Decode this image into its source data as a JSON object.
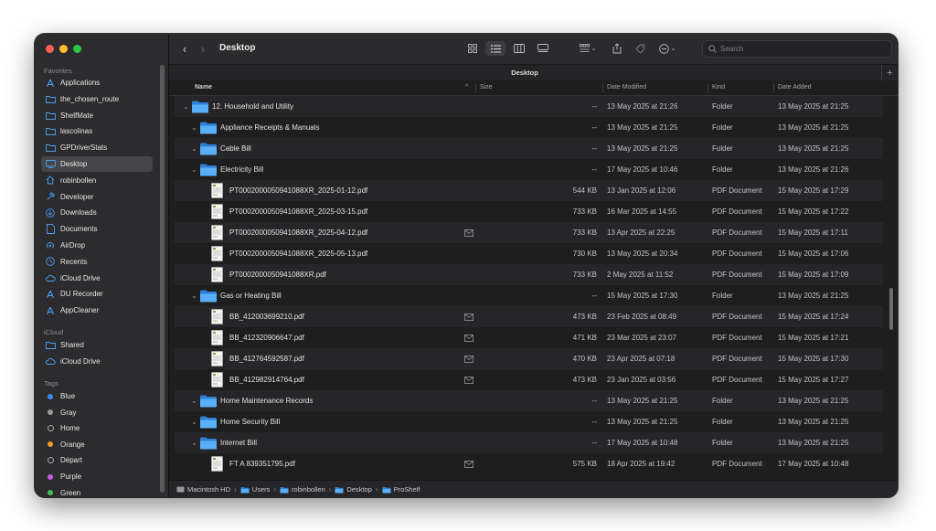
{
  "sidebar": {
    "favorites_title": "Favorites",
    "favorites": [
      {
        "label": "Applications",
        "icon": "applications-icon",
        "selected": false
      },
      {
        "label": "the_chosen_route",
        "icon": "folder-icon",
        "selected": false
      },
      {
        "label": "ShelfMate",
        "icon": "folder-icon",
        "selected": false
      },
      {
        "label": "lascolinas",
        "icon": "folder-icon",
        "selected": false
      },
      {
        "label": "GPDriverStats",
        "icon": "folder-icon",
        "selected": false
      },
      {
        "label": "Desktop",
        "icon": "desktop-icon",
        "selected": true
      },
      {
        "label": "robinbollen",
        "icon": "home-icon",
        "selected": false
      },
      {
        "label": "Developer",
        "icon": "hammer-icon",
        "selected": false
      },
      {
        "label": "Downloads",
        "icon": "download-icon",
        "selected": false
      },
      {
        "label": "Documents",
        "icon": "document-icon",
        "selected": false
      },
      {
        "label": "AirDrop",
        "icon": "airdrop-icon",
        "selected": false
      },
      {
        "label": "Recents",
        "icon": "clock-icon",
        "selected": false
      },
      {
        "label": "iCloud Drive",
        "icon": "cloud-icon",
        "selected": false
      },
      {
        "label": "DU Recorder",
        "icon": "app-icon",
        "selected": false
      },
      {
        "label": "AppCleaner",
        "icon": "app-icon",
        "selected": false
      }
    ],
    "icloud_title": "iCloud",
    "icloud": [
      {
        "label": "Shared",
        "icon": "shared-folder-icon"
      },
      {
        "label": "iCloud Drive",
        "icon": "cloud-icon"
      }
    ],
    "tags_title": "Tags",
    "tags": [
      {
        "label": "Blue",
        "color": "#3a8cf0"
      },
      {
        "label": "Gray",
        "color": "#9a9a9c"
      },
      {
        "label": "Home",
        "color": "hollow"
      },
      {
        "label": "Orange",
        "color": "#f29a2e"
      },
      {
        "label": "Départ",
        "color": "hollow"
      },
      {
        "label": "Purple",
        "color": "#c65de0"
      },
      {
        "label": "Green",
        "color": "#44c25a"
      }
    ]
  },
  "toolbar": {
    "title": "Desktop",
    "search_placeholder": "Search"
  },
  "tab": {
    "title": "Desktop"
  },
  "columns": {
    "name": "Name",
    "size": "Size",
    "date_modified": "Date Modified",
    "kind": "Kind",
    "date_added": "Date Added"
  },
  "rows": [
    {
      "indent": 0,
      "disclosure": "expanded",
      "type": "folder",
      "name": "12. Household and Utility",
      "shared": false,
      "size": "--",
      "modified": "13 May 2025 at 21:26",
      "kind": "Folder",
      "added": "13 May 2025 at 21:25"
    },
    {
      "indent": 1,
      "disclosure": "expanded",
      "type": "folder",
      "name": "Appliance Receipts & Manuals",
      "shared": false,
      "size": "--",
      "modified": "13 May 2025 at 21:25",
      "kind": "Folder",
      "added": "13 May 2025 at 21:25"
    },
    {
      "indent": 1,
      "disclosure": "expanded",
      "type": "folder",
      "name": "Cable Bill",
      "shared": false,
      "size": "--",
      "modified": "13 May 2025 at 21:25",
      "kind": "Folder",
      "added": "13 May 2025 at 21:25"
    },
    {
      "indent": 1,
      "disclosure": "expanded",
      "type": "folder",
      "name": "Electricity Bill",
      "shared": false,
      "size": "--",
      "modified": "17 May 2025 at 10:46",
      "kind": "Folder",
      "added": "13 May 2025 at 21:26"
    },
    {
      "indent": 2,
      "disclosure": "none",
      "type": "pdf",
      "name": "PT0002000050941088XR_2025-01-12.pdf",
      "shared": false,
      "size": "544 KB",
      "modified": "13 Jan 2025 at 12:06",
      "kind": "PDF Document",
      "added": "15 May 2025 at 17:29"
    },
    {
      "indent": 2,
      "disclosure": "none",
      "type": "pdf",
      "name": "PT0002000050941088XR_2025-03-15.pdf",
      "shared": false,
      "size": "733 KB",
      "modified": "16 Mar 2025 at 14:55",
      "kind": "PDF Document",
      "added": "15 May 2025 at 17:22"
    },
    {
      "indent": 2,
      "disclosure": "none",
      "type": "pdf",
      "name": "PT0002000050941088XR_2025-04-12.pdf",
      "shared": true,
      "size": "733 KB",
      "modified": "13 Apr 2025 at 22:25",
      "kind": "PDF Document",
      "added": "15 May 2025 at 17:11"
    },
    {
      "indent": 2,
      "disclosure": "none",
      "type": "pdf",
      "name": "PT0002000050941088XR_2025-05-13.pdf",
      "shared": false,
      "size": "730 KB",
      "modified": "13 May 2025 at 20:34",
      "kind": "PDF Document",
      "added": "15 May 2025 at 17:06"
    },
    {
      "indent": 2,
      "disclosure": "none",
      "type": "pdf",
      "name": "PT0002000050941088XR.pdf",
      "shared": false,
      "size": "733 KB",
      "modified": "2 May 2025 at 11:52",
      "kind": "PDF Document",
      "added": "15 May 2025 at 17:09"
    },
    {
      "indent": 1,
      "disclosure": "expanded",
      "type": "folder",
      "name": "Gas or Heating Bill",
      "shared": false,
      "size": "--",
      "modified": "15 May 2025 at 17:30",
      "kind": "Folder",
      "added": "13 May 2025 at 21:25"
    },
    {
      "indent": 2,
      "disclosure": "none",
      "type": "pdf",
      "name": "BB_412003699210.pdf",
      "shared": true,
      "size": "473 KB",
      "modified": "23 Feb 2025 at 08:49",
      "kind": "PDF Document",
      "added": "15 May 2025 at 17:24"
    },
    {
      "indent": 2,
      "disclosure": "none",
      "type": "pdf",
      "name": "BB_412320906647.pdf",
      "shared": true,
      "size": "471 KB",
      "modified": "23 Mar 2025 at 23:07",
      "kind": "PDF Document",
      "added": "15 May 2025 at 17:21"
    },
    {
      "indent": 2,
      "disclosure": "none",
      "type": "pdf",
      "name": "BB_412764592587.pdf",
      "shared": true,
      "size": "470 KB",
      "modified": "23 Apr 2025 at 07:18",
      "kind": "PDF Document",
      "added": "15 May 2025 at 17:30"
    },
    {
      "indent": 2,
      "disclosure": "none",
      "type": "pdf",
      "name": "BB_412982914764.pdf",
      "shared": true,
      "size": "473 KB",
      "modified": "23 Jan 2025 at 03:56",
      "kind": "PDF Document",
      "added": "15 May 2025 at 17:27"
    },
    {
      "indent": 1,
      "disclosure": "expanded",
      "type": "folder",
      "name": "Home Maintenance Records",
      "shared": false,
      "size": "--",
      "modified": "13 May 2025 at 21:25",
      "kind": "Folder",
      "added": "13 May 2025 at 21:25"
    },
    {
      "indent": 1,
      "disclosure": "expanded",
      "type": "folder",
      "name": "Home Security Bill",
      "shared": false,
      "size": "--",
      "modified": "13 May 2025 at 21:25",
      "kind": "Folder",
      "added": "13 May 2025 at 21:25"
    },
    {
      "indent": 1,
      "disclosure": "expanded",
      "type": "folder",
      "name": "Internet Bill",
      "shared": false,
      "size": "--",
      "modified": "17 May 2025 at 10:48",
      "kind": "Folder",
      "added": "13 May 2025 at 21:25"
    },
    {
      "indent": 2,
      "disclosure": "none",
      "type": "pdf",
      "name": "FT A 839351795.pdf",
      "shared": true,
      "size": "575 KB",
      "modified": "18 Apr 2025 at 19:42",
      "kind": "PDF Document",
      "added": "17 May 2025 at 10:48"
    }
  ],
  "pathbar": [
    {
      "label": "Macintosh HD",
      "icon": "disk-icon"
    },
    {
      "label": "Users",
      "icon": "folder-icon"
    },
    {
      "label": "robinbollen",
      "icon": "folder-icon"
    },
    {
      "label": "Desktop",
      "icon": "folder-icon"
    },
    {
      "label": "ProShelf",
      "icon": "folder-icon"
    }
  ],
  "colors": {
    "accent": "#4a9ff5",
    "window_bg": "#1e1e1e",
    "sidebar_bg": "#2c2c2e"
  }
}
